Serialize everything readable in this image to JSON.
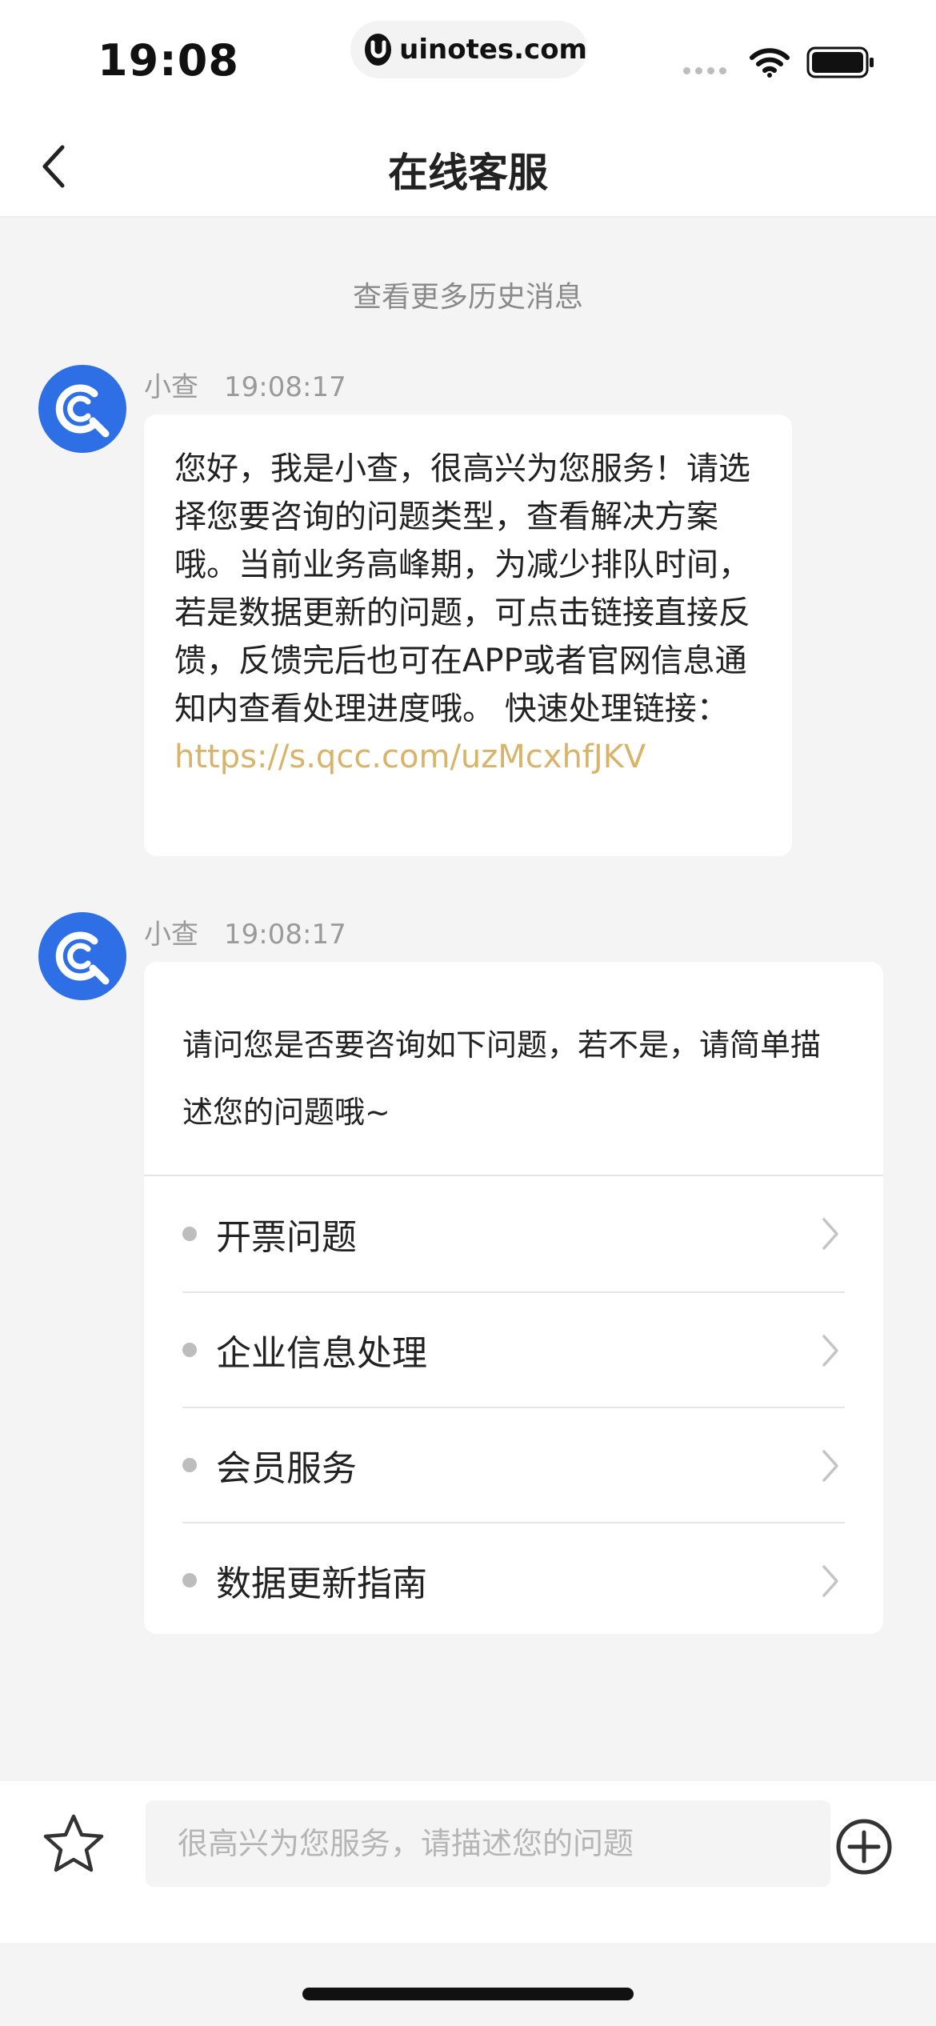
{
  "status_bar": {
    "time": "19:08",
    "url": "uinotes.com"
  },
  "nav": {
    "title": "在线客服"
  },
  "chat": {
    "history_link": "查看更多历史消息",
    "messages": [
      {
        "sender": "小查",
        "time": "19:08:17",
        "text": "您好，我是小查，很高兴为您服务！请选择您要咨询的问题类型，查看解决方案哦。当前业务高峰期，为减少排队时间，若是数据更新的问题，可点击链接直接反馈，反馈完后也可在APP或者官网信息通知内查看处理进度哦。 快速处理链接：",
        "link": "https://s.qcc.com/uzMcxhfJKV"
      },
      {
        "sender": "小查",
        "time": "19:08:17",
        "text": "请问您是否要咨询如下问题，若不是，请简单描述您的问题哦~",
        "options": [
          {
            "label": "开票问题"
          },
          {
            "label": "企业信息处理"
          },
          {
            "label": "会员服务"
          },
          {
            "label": "数据更新指南"
          }
        ]
      }
    ]
  },
  "input": {
    "placeholder": "很高兴为您服务，请描述您的问题",
    "value": ""
  },
  "colors": {
    "link": "#d8b46a",
    "avatar": "#2f6fe6"
  }
}
